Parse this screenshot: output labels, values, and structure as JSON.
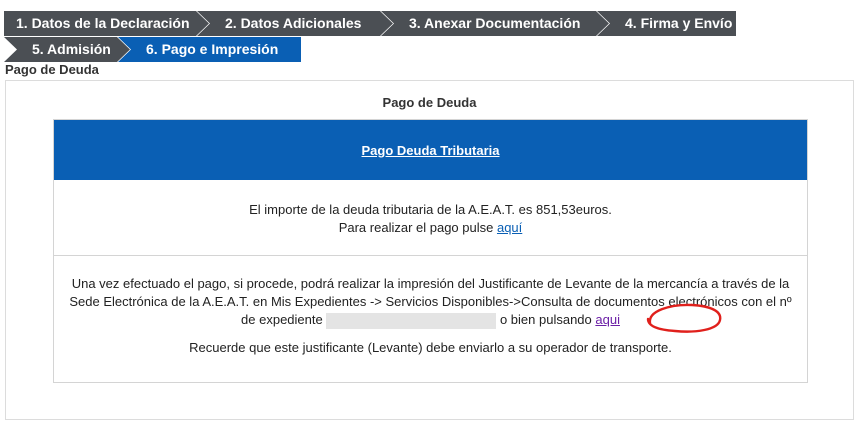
{
  "steps": [
    {
      "label": "1. Datos de la Declaración"
    },
    {
      "label": "2. Datos Adicionales"
    },
    {
      "label": "3. Anexar Documentación"
    },
    {
      "label": "4. Firma y Envío"
    },
    {
      "label": "5. Admisión"
    },
    {
      "label": "6. Pago e Impresión",
      "active": true
    }
  ],
  "section_label": "Pago de Deuda",
  "panel": {
    "title": "Pago de Deuda",
    "header_link": "Pago Deuda Tributaria",
    "debt_line": "El importe de la deuda tributaria de la A.E.A.T. es 851,53euros.",
    "pay_prefix": "Para realizar el pago pulse ",
    "pay_link": "aquí",
    "info_part1": "Una vez efectuado el pago, si procede, podrá realizar la impresión del Justificante de Levante de la mercancía a través de la Sede Electrónica de la A.E.A.T. en Mis Expedientes -> Servicios Disponibles->Consulta de documentos electrónicos con el nº de expediente ",
    "info_part2": " o bien pulsando ",
    "print_link": "aqui",
    "reminder": "Recuerde que este justificante (Levante) debe enviarlo a su operador de transporte."
  },
  "colors": {
    "tab_bg": "#4b4f54",
    "tab_active": "#0a5fb4",
    "header_bg": "#0a5fb4",
    "annotation": "#e0201c"
  }
}
